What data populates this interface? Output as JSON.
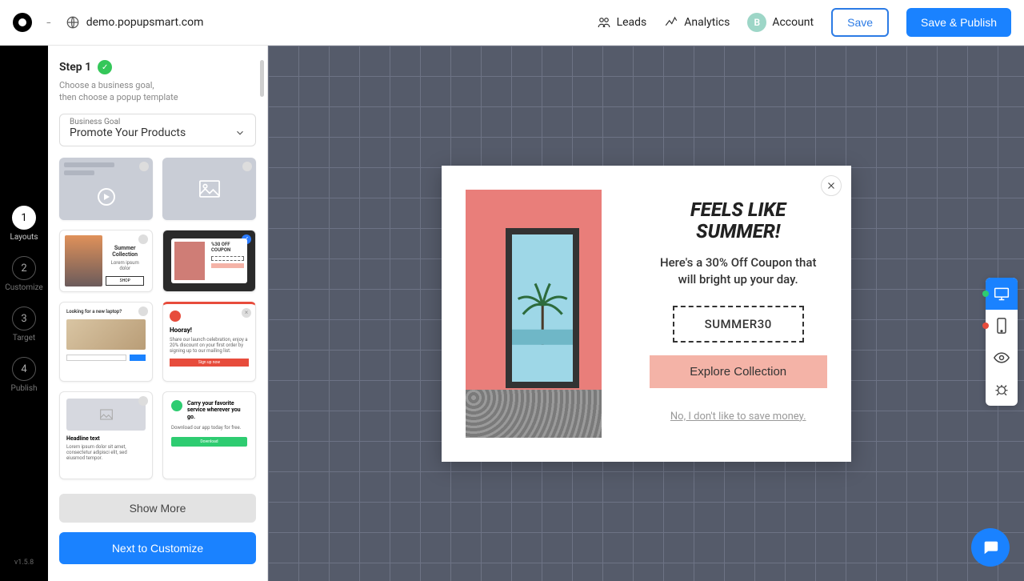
{
  "top": {
    "separator": "-",
    "site": "demo.popupsmart.com",
    "leads": "Leads",
    "analytics": "Analytics",
    "account_initial": "B",
    "account": "Account",
    "save": "Save",
    "publish": "Save & Publish"
  },
  "rail": {
    "steps": [
      {
        "num": "1",
        "label": "Layouts",
        "active": true
      },
      {
        "num": "2",
        "label": "Customize",
        "active": false
      },
      {
        "num": "3",
        "label": "Target",
        "active": false
      },
      {
        "num": "4",
        "label": "Publish",
        "active": false
      }
    ],
    "version": "v1.5.8"
  },
  "sidebar": {
    "step_label": "Step 1",
    "sub1": "Choose a business goal,",
    "sub2": "then choose a popup template",
    "goal_label": "Business Goal",
    "goal_value": "Promote Your Products",
    "show_more": "Show More",
    "next": "Next to Customize",
    "templates": {
      "t3_title": "Summer Collection",
      "t5_title": "Looking for a new laptop?",
      "t6_title": "Hooray!",
      "t6_desc": "Share our launch celebration, enjoy a 20% discount on your first order by signing up to our mailing list.",
      "t6_btn": "Sign up now",
      "t7_title": "Headline text",
      "t7_desc": "Lorem ipsum dolor sit amet, consectetur adipisci elit, sed eiusmod tempor.",
      "t8_title": "Carry your favorite service wherever you go.",
      "t8_desc": "Download our app today for free.",
      "t8_btn": "Download"
    }
  },
  "popup": {
    "title1": "FEELS LIKE",
    "title2": "SUMMER!",
    "desc": "Here's a 30% Off Coupon that will bright up your day.",
    "coupon": "SUMMER30",
    "cta": "Explore Collection",
    "decline": "No, I don't like to save money."
  },
  "colors": {
    "primary": "#1a82ff",
    "cta_bg": "#f4b3a7"
  }
}
